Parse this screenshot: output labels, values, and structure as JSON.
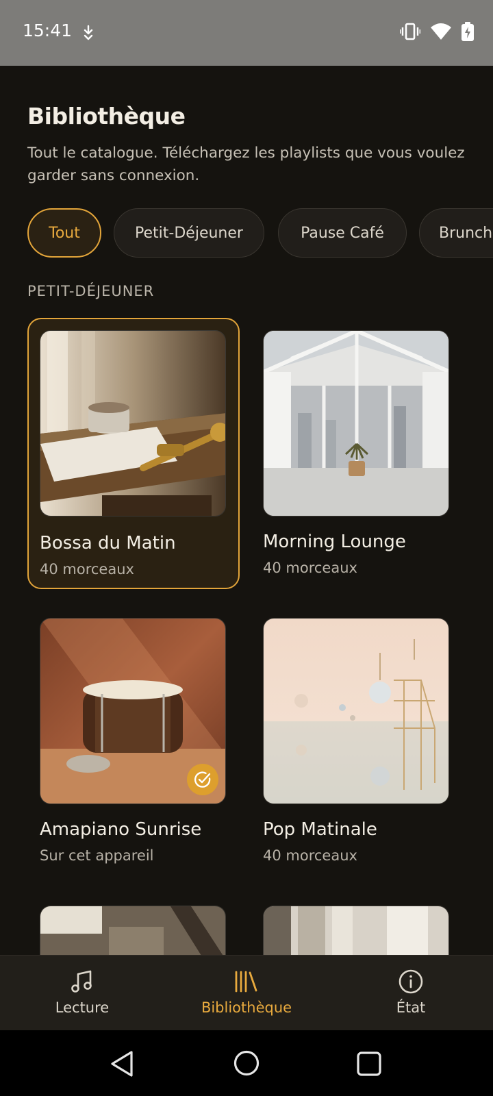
{
  "status_bar": {
    "time": "15:41"
  },
  "header": {
    "title": "Bibliothèque",
    "subtitle": "Tout le catalogue. Téléchargez les playlists que vous voulez garder sans connexion."
  },
  "filters": {
    "chips": [
      {
        "label": "Tout",
        "active": true
      },
      {
        "label": "Petit-Déjeuner",
        "active": false
      },
      {
        "label": "Pause Café",
        "active": false
      },
      {
        "label": "Brunch",
        "active": false
      }
    ]
  },
  "section": {
    "label": "PETIT-DÉJEUNER"
  },
  "playlists": [
    {
      "title": "Bossa du Matin",
      "subtitle": "40 morceaux",
      "selected": true,
      "downloaded": false
    },
    {
      "title": "Morning Lounge",
      "subtitle": "40 morceaux",
      "selected": false,
      "downloaded": false
    },
    {
      "title": "Amapiano Sunrise",
      "subtitle": "Sur cet appareil",
      "selected": false,
      "downloaded": true
    },
    {
      "title": "Pop Matinale",
      "subtitle": "40 morceaux",
      "selected": false,
      "downloaded": false
    }
  ],
  "bottom_nav": {
    "items": [
      {
        "label": "Lecture",
        "icon": "music-note-icon",
        "active": false
      },
      {
        "label": "Bibliothèque",
        "icon": "library-icon",
        "active": true
      },
      {
        "label": "État",
        "icon": "info-icon",
        "active": false
      }
    ]
  },
  "colors": {
    "accent": "#e3a53a",
    "background": "#15130f",
    "card_selected_bg": "#2a2112"
  }
}
